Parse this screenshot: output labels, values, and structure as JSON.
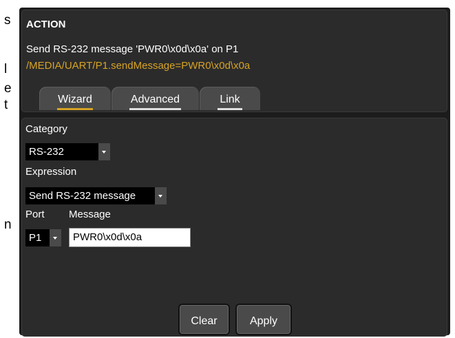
{
  "background_text": {
    "fragments": [
      "s",
      "l",
      "e",
      "t",
      "n"
    ]
  },
  "action": {
    "title": "ACTION",
    "description": "Send RS-232 message 'PWR0\\x0d\\x0a' on P1",
    "command": "/MEDIA/UART/P1.sendMessage=PWR0\\x0d\\x0a"
  },
  "tabs": [
    {
      "label": "Wizard",
      "active": true
    },
    {
      "label": "Advanced",
      "active": false
    },
    {
      "label": "Link",
      "active": false
    }
  ],
  "wizard": {
    "category_label": "Category",
    "category_value": "RS-232",
    "expression_label": "Expression",
    "expression_value": "Send RS-232 message",
    "port_label": "Port",
    "port_value": "P1",
    "message_label": "Message",
    "message_value": "PWR0\\x0d\\x0a"
  },
  "buttons": {
    "clear": "Clear",
    "apply": "Apply"
  },
  "colors": {
    "accent": "#d7a325",
    "panel_bg": "#2b2b2b",
    "tab_bg": "#4a4a4a"
  }
}
